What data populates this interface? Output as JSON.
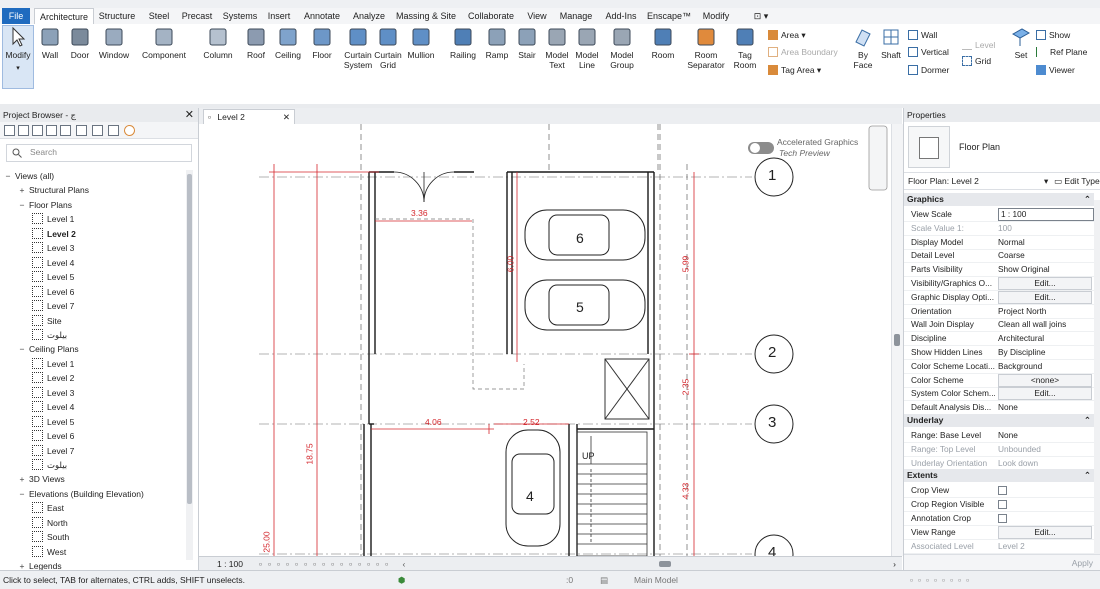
{
  "menu": {
    "tabs": [
      "File",
      "Architecture",
      "Structure",
      "Steel",
      "Precast",
      "Systems",
      "Insert",
      "Annotate",
      "Analyze",
      "Massing & Site",
      "Collaborate",
      "View",
      "Manage",
      "Add-Ins",
      "Enscape™",
      "Modify"
    ],
    "active": "Architecture"
  },
  "ribbon": {
    "modify": "Modify",
    "tools": [
      {
        "label": "Wall",
        "icon": "wall-icon"
      },
      {
        "label": "Door",
        "icon": "door-icon"
      },
      {
        "label": "Window",
        "icon": "window-icon"
      },
      {
        "label": "Component",
        "icon": "component-icon"
      },
      {
        "label": "Column",
        "icon": "column-icon"
      },
      {
        "label": "Roof",
        "icon": "roof-icon"
      },
      {
        "label": "Ceiling",
        "icon": "ceiling-icon"
      },
      {
        "label": "Floor",
        "icon": "floor-icon"
      },
      {
        "label": "Curtain System",
        "icon": "curtain-system-icon"
      },
      {
        "label": "Curtain Grid",
        "icon": "curtain-grid-icon"
      },
      {
        "label": "Mullion",
        "icon": "mullion-icon"
      },
      {
        "label": "Railing",
        "icon": "railing-icon"
      },
      {
        "label": "Ramp",
        "icon": "ramp-icon"
      },
      {
        "label": "Stair",
        "icon": "stair-icon"
      },
      {
        "label": "Model Text",
        "icon": "model-text-icon"
      },
      {
        "label": "Model Line",
        "icon": "model-line-icon"
      },
      {
        "label": "Model Group",
        "icon": "model-group-icon"
      },
      {
        "label": "Room",
        "icon": "room-icon"
      },
      {
        "label": "Room Separator",
        "icon": "room-separator-icon"
      },
      {
        "label": "Tag Room",
        "icon": "tag-room-icon"
      }
    ],
    "small": {
      "area": "Area",
      "area_boundary": "Area Boundary",
      "tag_area": "Tag Area",
      "by_face": "By Face",
      "shaft": "Shaft",
      "wall": "Wall",
      "vertical": "Vertical",
      "dormer": "Dormer",
      "level": "Level",
      "grid": "Grid",
      "set": "Set",
      "show": "Show",
      "ref_plane": "Ref Plane",
      "viewer": "Viewer"
    }
  },
  "project_browser": {
    "title": "Project Browser - ج",
    "search_placeholder": "Search",
    "tree": [
      {
        "label": "Views (all)",
        "level": 0,
        "expander": "−"
      },
      {
        "label": "Structural Plans",
        "level": 1,
        "expander": "+"
      },
      {
        "label": "Floor Plans",
        "level": 1,
        "expander": "−"
      },
      {
        "label": "Level 1",
        "level": 2,
        "view": true
      },
      {
        "label": "Level 2",
        "level": 2,
        "view": true,
        "bold": true
      },
      {
        "label": "Level 3",
        "level": 2,
        "view": true
      },
      {
        "label": "Level 4",
        "level": 2,
        "view": true
      },
      {
        "label": "Level 5",
        "level": 2,
        "view": true
      },
      {
        "label": "Level 6",
        "level": 2,
        "view": true
      },
      {
        "label": "Level 7",
        "level": 2,
        "view": true
      },
      {
        "label": "Site",
        "level": 2,
        "view": true
      },
      {
        "label": "بيلوت",
        "level": 2,
        "view": true
      },
      {
        "label": "Ceiling Plans",
        "level": 1,
        "expander": "−"
      },
      {
        "label": "Level 1",
        "level": 2,
        "view": true
      },
      {
        "label": "Level 2",
        "level": 2,
        "view": true
      },
      {
        "label": "Level 3",
        "level": 2,
        "view": true
      },
      {
        "label": "Level 4",
        "level": 2,
        "view": true
      },
      {
        "label": "Level 5",
        "level": 2,
        "view": true
      },
      {
        "label": "Level 6",
        "level": 2,
        "view": true
      },
      {
        "label": "Level 7",
        "level": 2,
        "view": true
      },
      {
        "label": "بيلوت",
        "level": 2,
        "view": true
      },
      {
        "label": "3D Views",
        "level": 1,
        "expander": "+"
      },
      {
        "label": "Elevations (Building Elevation)",
        "level": 1,
        "expander": "−"
      },
      {
        "label": "East",
        "level": 2,
        "view": true
      },
      {
        "label": "North",
        "level": 2,
        "view": true
      },
      {
        "label": "South",
        "level": 2,
        "view": true
      },
      {
        "label": "West",
        "level": 2,
        "view": true
      },
      {
        "label": "Legends",
        "level": 1,
        "expander": "+"
      }
    ]
  },
  "view": {
    "tab_label": "Level 2",
    "accelerated": "Accelerated Graphics",
    "tech_preview": "Tech Preview",
    "scale": "1 : 100",
    "grid_bubbles": [
      "1",
      "2",
      "3",
      "4"
    ],
    "dimensions": [
      "3.36",
      "6.00",
      "5.99",
      "2.35",
      "4.06",
      "2.52",
      "4.33",
      "18.75",
      "25.00"
    ],
    "car_numbers": [
      "6",
      "5",
      "4"
    ],
    "stair_label": "UP"
  },
  "properties": {
    "title": "Properties",
    "type_name": "Floor Plan",
    "selector": "Floor Plan: Level 2",
    "edit_type": "Edit Type",
    "sections": {
      "graphics": "Graphics",
      "underlay": "Underlay",
      "extents": "Extents"
    },
    "graphics_rows": [
      {
        "name": "View Scale",
        "value": "1 : 100",
        "kind": "input"
      },
      {
        "name": "Scale Value    1:",
        "value": "100",
        "disabled": true
      },
      {
        "name": "Display Model",
        "value": "Normal"
      },
      {
        "name": "Detail Level",
        "value": "Coarse"
      },
      {
        "name": "Parts Visibility",
        "value": "Show Original"
      },
      {
        "name": "Visibility/Graphics O...",
        "value": "Edit...",
        "kind": "button"
      },
      {
        "name": "Graphic Display Opti...",
        "value": "Edit...",
        "kind": "button"
      },
      {
        "name": "Orientation",
        "value": "Project North"
      },
      {
        "name": "Wall Join Display",
        "value": "Clean all wall joins"
      },
      {
        "name": "Discipline",
        "value": "Architectural"
      },
      {
        "name": "Show Hidden Lines",
        "value": "By Discipline"
      },
      {
        "name": "Color Scheme Locati...",
        "value": "Background"
      },
      {
        "name": "Color Scheme",
        "value": "<none>",
        "kind": "button"
      },
      {
        "name": "System Color Schem...",
        "value": "Edit...",
        "kind": "button"
      },
      {
        "name": "Default Analysis Dis...",
        "value": "None"
      }
    ],
    "underlay_rows": [
      {
        "name": "Range: Base Level",
        "value": "None"
      },
      {
        "name": "Range: Top Level",
        "value": "Unbounded",
        "disabled": true
      },
      {
        "name": "Underlay Orientation",
        "value": "Look down",
        "disabled": true
      }
    ],
    "extents_rows": [
      {
        "name": "Crop View",
        "value": "",
        "kind": "check"
      },
      {
        "name": "Crop Region Visible",
        "value": "",
        "kind": "check"
      },
      {
        "name": "Annotation Crop",
        "value": "",
        "kind": "check"
      },
      {
        "name": "View Range",
        "value": "Edit...",
        "kind": "button"
      },
      {
        "name": "Associated Level",
        "value": "Level 2",
        "disabled": true
      }
    ],
    "apply": "Apply"
  },
  "status": {
    "hint": "Click to select, TAB for alternates, CTRL adds, SHIFT unselects.",
    "model": "Main Model",
    "count": ":0"
  },
  "colors": {
    "accent": "#1f6bbf",
    "dimension": "#d4262c",
    "wall": "#1a1a1a"
  }
}
